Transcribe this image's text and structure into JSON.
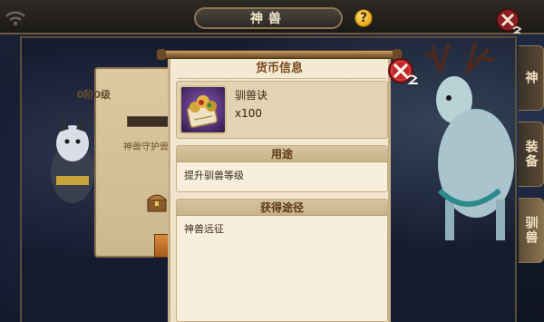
{
  "header": {
    "title": "神兽",
    "help_symbol": "?"
  },
  "side_tabs": [
    {
      "label": "神"
    },
    {
      "label": "装备"
    },
    {
      "label": "驯兽",
      "active": true
    }
  ],
  "background_panel": {
    "level_text": "0阶0级",
    "subtitle": "神兽守护兽"
  },
  "dialog": {
    "title": "货币信息",
    "item": {
      "name": "驯兽诀",
      "count": "x100"
    },
    "usage": {
      "heading": "用途",
      "text": "提升驯兽等级"
    },
    "source": {
      "heading": "获得途径",
      "text": "神兽远征"
    }
  },
  "icons": [
    "wifi-icon",
    "help-icon",
    "close-icon",
    "scroll-item-icon"
  ],
  "colors": {
    "parchment": "#f4ead4",
    "title_text": "#7a4a1e",
    "section_header": "#d7c4a0",
    "close_red": "#c0262a"
  }
}
